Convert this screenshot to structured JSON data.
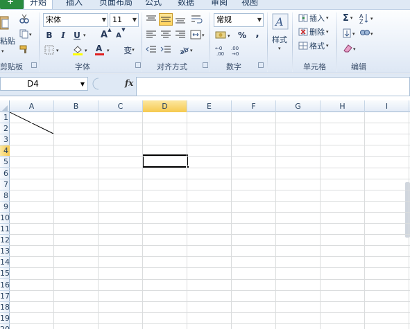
{
  "tabs": [
    {
      "label": "开始",
      "active": true
    },
    {
      "label": "插入",
      "active": false
    },
    {
      "label": "页面布局",
      "active": false
    },
    {
      "label": "公式",
      "active": false
    },
    {
      "label": "数据",
      "active": false
    },
    {
      "label": "审阅",
      "active": false
    },
    {
      "label": "视图",
      "active": false
    }
  ],
  "ribbon": {
    "clipboard": {
      "paste_label": "粘贴",
      "group_label": "剪贴板"
    },
    "font": {
      "font_name": "宋体",
      "font_size": "11",
      "bold": "B",
      "italic": "I",
      "underline": "U",
      "grow": "A",
      "shrink": "A",
      "font_color_glyph": "A",
      "phonetic_glyph": "变",
      "group_label": "字体"
    },
    "alignment": {
      "group_label": "对齐方式"
    },
    "number": {
      "format": "常规",
      "percent": "%",
      "comma": ",",
      "group_label": "数字"
    },
    "styles": {
      "label": "样式"
    },
    "cells": {
      "insert": "插入",
      "delete": "删除",
      "format": "格式",
      "group_label": "单元格"
    },
    "editing": {
      "sum": "Σ",
      "group_label": "编辑"
    }
  },
  "formula_bar": {
    "name_box": "D4",
    "fx": "fx",
    "formula": ""
  },
  "sheet": {
    "columns": [
      "A",
      "B",
      "C",
      "D",
      "E",
      "F",
      "G",
      "H",
      "I"
    ],
    "rows": [
      "1",
      "2",
      "3",
      "4",
      "5",
      "6",
      "7",
      "8",
      "9",
      "10",
      "11",
      "12",
      "13",
      "14",
      "15",
      "16",
      "17",
      "18",
      "19",
      "20"
    ],
    "active_column": "D",
    "active_row": "4",
    "active_cell": "D4"
  },
  "colors": {
    "file_tab": "#2a8b3e",
    "active_header": "#f6c94f",
    "highlight": "#ffd25a"
  }
}
